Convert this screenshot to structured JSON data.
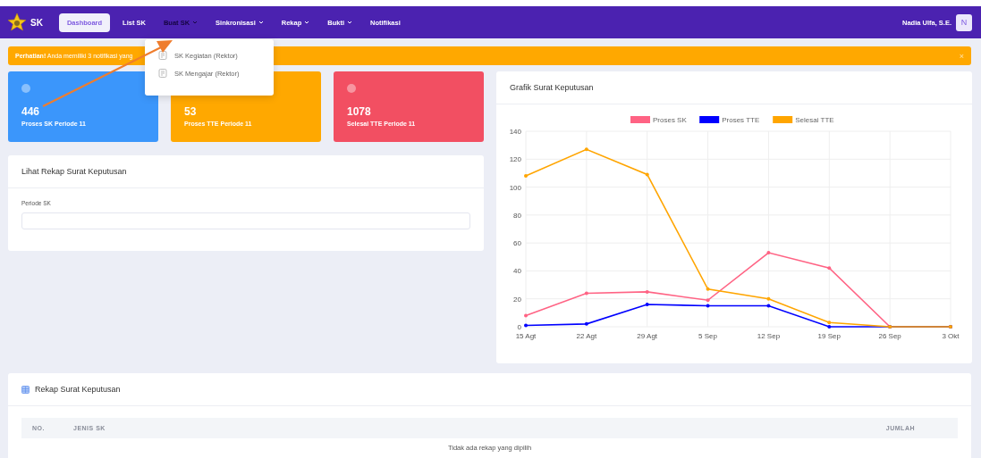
{
  "navbar": {
    "brand": "SK",
    "items": [
      {
        "label": "Dashboard",
        "selected": true,
        "has_dropdown": false,
        "expanded": false
      },
      {
        "label": "List SK",
        "selected": false,
        "has_dropdown": false,
        "expanded": false
      },
      {
        "label": "Buat SK",
        "selected": false,
        "has_dropdown": true,
        "expanded": true
      },
      {
        "label": "Sinkronisasi",
        "selected": false,
        "has_dropdown": true,
        "expanded": false
      },
      {
        "label": "Rekap",
        "selected": false,
        "has_dropdown": true,
        "expanded": false
      },
      {
        "label": "Bukti",
        "selected": false,
        "has_dropdown": true,
        "expanded": false
      },
      {
        "label": "Notifikasi",
        "selected": false,
        "has_dropdown": false,
        "expanded": false
      }
    ],
    "user": {
      "name": "Nadia Ulfa, S.E.",
      "avatar": "N"
    }
  },
  "dropdown": {
    "items": [
      "SK Kegiatan (Rektor)",
      "SK Mengajar (Rektor)"
    ]
  },
  "alert": {
    "text": "**Perhatian!** Anda memiliki 3 notifikasi yang",
    "close": "×"
  },
  "stats": [
    {
      "value": "446",
      "label": "Proses SK Periode 11",
      "color": "#3b96fb"
    },
    {
      "value": "53",
      "label": "Proses TTE Periode 11",
      "color": "#ffa800"
    },
    {
      "value": "1078",
      "label": "Selesai TTE Periode 11",
      "color": "#f24f62"
    }
  ],
  "rekap_form": {
    "title": "Lihat Rekap Surat Keputusan",
    "field_label": "Periode SK"
  },
  "chart_card": {
    "title": "Grafik Surat Keputusan",
    "chart_data": {
      "type": "line",
      "grid": true,
      "legend": true,
      "categories": [
        "15 Agt",
        "22 Agt",
        "29 Agt",
        "5 Sep",
        "12 Sep",
        "19 Sep",
        "26 Sep",
        "3 Okt"
      ],
      "ylim": [
        0,
        140
      ],
      "yticks": [
        0,
        20,
        40,
        60,
        80,
        100,
        120,
        140
      ],
      "series": [
        {
          "name": "Proses SK",
          "color": "#ff6384",
          "values": [
            8,
            24,
            25,
            19,
            53,
            42,
            0,
            0
          ]
        },
        {
          "name": "Proses TTE",
          "color": "#0000ff",
          "values": [
            1,
            2,
            16,
            15,
            15,
            0,
            0,
            0
          ]
        },
        {
          "name": "Selesai TTE",
          "color": "#ffa500",
          "values": [
            108,
            127,
            109,
            27,
            20,
            3,
            0,
            0
          ]
        }
      ]
    }
  },
  "rekap_table": {
    "title": "Rekap Surat Keputusan",
    "columns": [
      "NO.",
      "JENIS SK",
      "JUMLAH"
    ],
    "empty_message": "Tidak ada rekap yang dipilih"
  }
}
